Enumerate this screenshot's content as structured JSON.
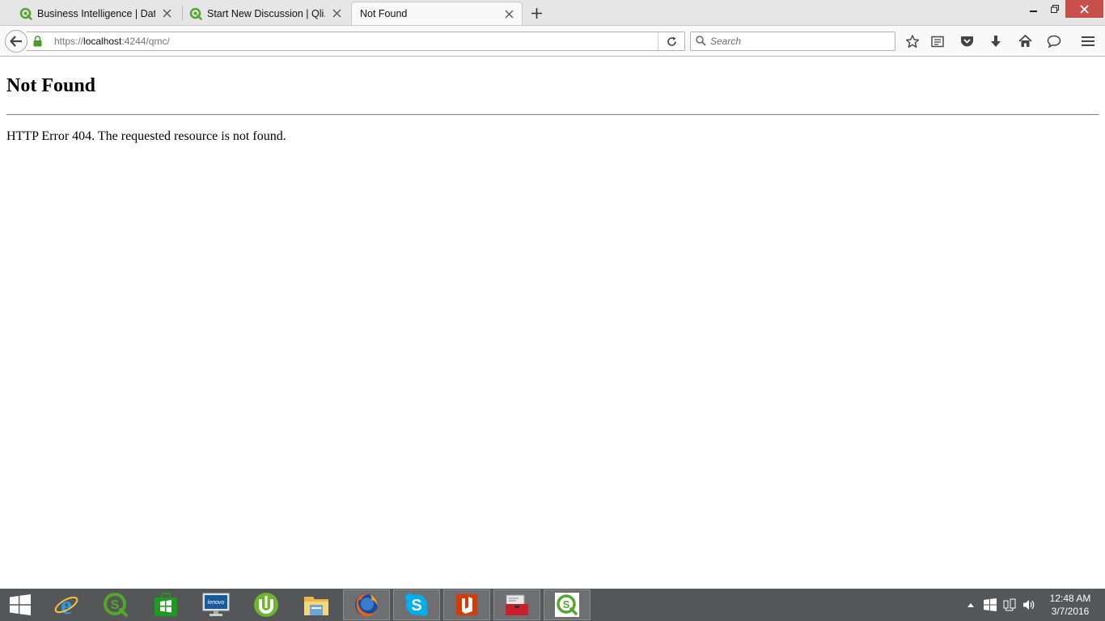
{
  "window": {
    "minimize_icon": "minimize-icon",
    "maximize_icon": "restore-icon",
    "close_icon": "close-icon",
    "close_color": "#c7504a"
  },
  "tabs": [
    {
      "title": "Business Intelligence | Dat...",
      "favicon": "qlik-icon",
      "active": false
    },
    {
      "title": "Start New Discussion | Qli...",
      "favicon": "qlik-icon",
      "active": false
    },
    {
      "title": "Not Found",
      "favicon": "",
      "active": true
    }
  ],
  "navbar": {
    "url_scheme": "https://",
    "url_host": "localhost",
    "url_rest": ":4244/qmc/",
    "search_placeholder": "Search",
    "toolbar_icons": [
      "bookmark-star-icon",
      "reading-list-icon",
      "pocket-icon",
      "download-icon",
      "home-icon",
      "chat-icon",
      "menu-icon"
    ]
  },
  "page": {
    "heading": "Not Found",
    "message": "HTTP Error 404. The requested resource is not found."
  },
  "taskbar": {
    "apps": [
      "start-icon",
      "internet-explorer-icon",
      "qlik-sense-icon",
      "windows-store-icon",
      "lenovo-icon",
      "utorrent-icon",
      "file-explorer-icon",
      "firefox-icon",
      "skype-icon",
      "office-icon",
      "toolbox-icon",
      "qlik-sense-desktop-icon"
    ],
    "tray_icons": [
      "show-hidden-icons-icon",
      "action-center-icon",
      "network-icon",
      "volume-icon"
    ],
    "time": "12:48 AM",
    "date": "3/7/2016"
  },
  "colors": {
    "qlik_green": "#52a82a",
    "taskbar": "#545657",
    "lock_green": "#4a9a2a"
  }
}
